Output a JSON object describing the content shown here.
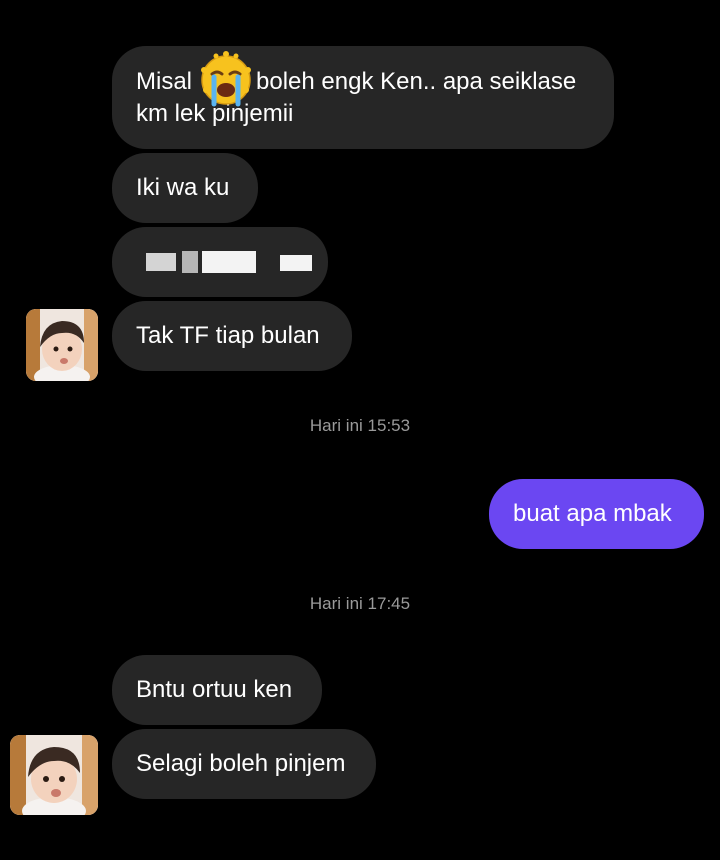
{
  "messages": [
    {
      "text": "Misal 😭 boleh engk Ken.. apa seiklase km lek pinjemii"
    },
    {
      "text": "Iki wa ku"
    },
    {
      "text": "",
      "note_redacted": true
    },
    {
      "text": "Tak TF tiap bulan"
    },
    {
      "timestamp": "Hari ini 15:53"
    },
    {
      "text": "buat apa mbak"
    },
    {
      "timestamp": "Hari ini 17:45"
    },
    {
      "text": "Bntu ortuu ken"
    },
    {
      "text": "Selagi boleh pinjem"
    }
  ],
  "msg1": {
    "line1_a": "Misal",
    "line1_b": "boleh engk Ken.. apa seiklase",
    "line2": "km lek pinjemii",
    "emoji": "loudly-crying-face-icon"
  },
  "msg2": {
    "text": "Iki wa ku"
  },
  "msg4": {
    "text": "Tak TF tiap bulan"
  },
  "ts1": {
    "text": "Hari ini 15:53"
  },
  "sent1": {
    "text": "buat apa mbak"
  },
  "ts2": {
    "text": "Hari ini 17:45"
  },
  "msg5": {
    "text": "Bntu ortuu ken"
  },
  "msg6": {
    "text": "Selagi boleh pinjem"
  },
  "colors": {
    "background": "#000000",
    "incoming_bubble": "#262626",
    "outgoing_bubble": "#6b47f2",
    "timestamp": "#9a9a9a"
  }
}
